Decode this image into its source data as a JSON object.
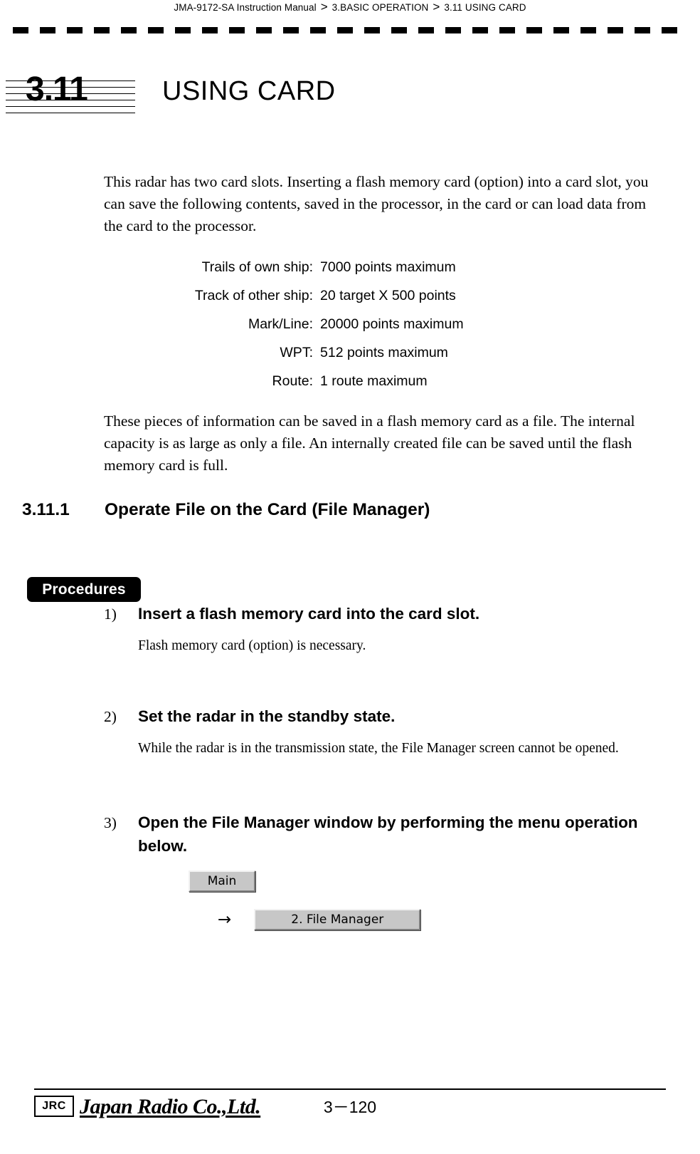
{
  "header": {
    "manual": "JMA-9172-SA Instruction Manual",
    "separator": ">",
    "chapter": "3.BASIC OPERATION",
    "section": "3.11  USING CARD"
  },
  "title": {
    "number": "3.11",
    "text": "USING CARD"
  },
  "intro_paragraph": "This radar has two card slots. Inserting a flash memory card (option) into a card slot, you can save the following contents, saved in the processor, in the card or can load data from the card to the processor.",
  "spec_table": {
    "rows": [
      {
        "label": "Trails of own ship:",
        "value": "7000 points maximum"
      },
      {
        "label": "Track of other ship:",
        "value": "20 target X 500 points"
      },
      {
        "label": "Mark/Line:",
        "value": "20000 points maximum"
      },
      {
        "label": "WPT:",
        "value": "512 points maximum"
      },
      {
        "label": "Route:",
        "value": "1 route maximum"
      }
    ]
  },
  "capacity_paragraph": "These pieces of information can be saved in a flash memory card as a file. The internal capacity is as large as only a file. An internally created file can be saved until the flash memory card is full.",
  "section_heading": {
    "number": "3.11.1",
    "text": "Operate File on the Card (File Manager)"
  },
  "procedures_badge": "Procedures",
  "steps": [
    {
      "num": "1)",
      "title": "Insert a flash memory card into the card slot.",
      "body": "Flash memory card (option) is necessary."
    },
    {
      "num": "2)",
      "title": "Set the radar in the standby state.",
      "body": "While the radar is in the transmission state, the File Manager screen cannot be opened."
    },
    {
      "num": "3)",
      "title": "Open the File Manager window by performing the menu operation below.",
      "body": ""
    }
  ],
  "menu_flow": {
    "main_button": "Main",
    "arrow": "→",
    "file_manager_button": "2. File Manager"
  },
  "footer": {
    "logo_mark": "JRC",
    "wordmark": "Japan Radio Co.,Ltd.",
    "page_number": "3－120"
  }
}
